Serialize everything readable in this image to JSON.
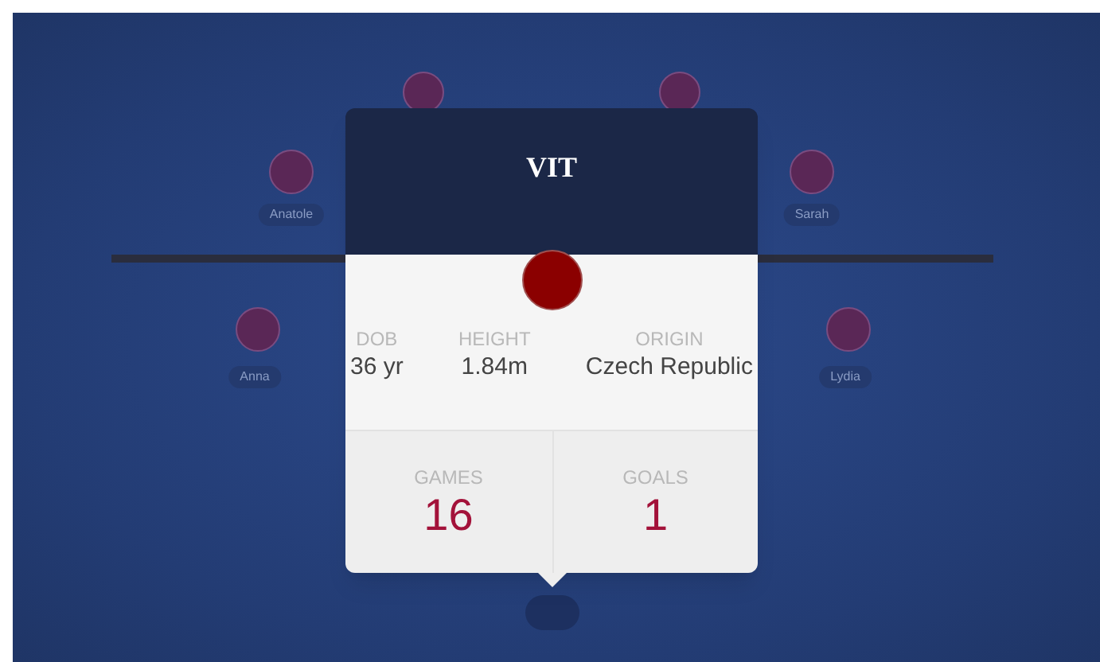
{
  "players": [
    {
      "name": "Anatole"
    },
    {
      "name": "Sarah"
    },
    {
      "name": "Anna"
    },
    {
      "name": "Lydia"
    }
  ],
  "card": {
    "title": "VIT",
    "details": [
      {
        "label": "DOB",
        "value": "36 yr"
      },
      {
        "label": "HEIGHT",
        "value": "1.84m"
      },
      {
        "label": "ORIGIN",
        "value": "Czech Republic"
      }
    ],
    "totals": [
      {
        "label": "GAMES",
        "value": "16"
      },
      {
        "label": "GOALS",
        "value": "1"
      }
    ]
  }
}
